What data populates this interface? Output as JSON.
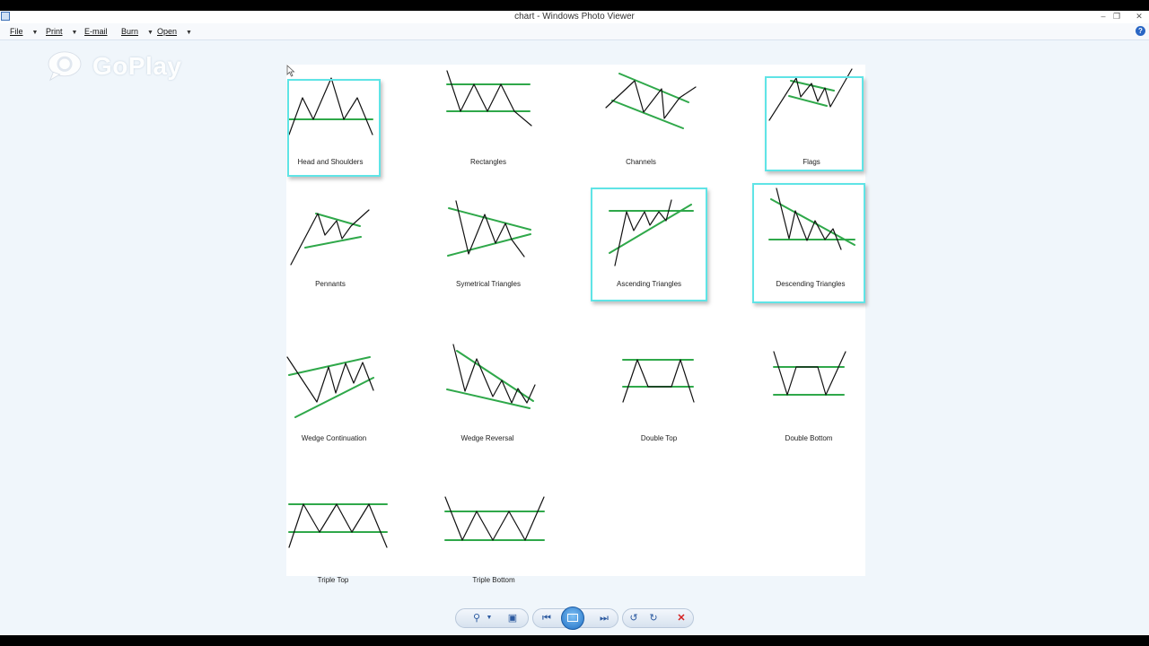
{
  "window": {
    "title": "chart - Windows Photo Viewer"
  },
  "menu": {
    "file": "File",
    "print": "Print",
    "email": "E-mail",
    "burn": "Burn",
    "open": "Open"
  },
  "watermark": {
    "text": "GoPlay"
  },
  "patterns": [
    "Head and Shoulders",
    "Rectangles",
    "Channels",
    "Flags",
    "Pennants",
    "Symetrical Triangles",
    "Ascending Triangles",
    "Descending Triangles",
    "Wedge Continuation",
    "Wedge Reversal",
    "Double Top",
    "Double Bottom",
    "Triple Top",
    "Triple Bottom"
  ],
  "toolbar_icons": [
    "zoom-icon",
    "actual-size-icon",
    "previous-icon",
    "slideshow-icon",
    "next-icon",
    "rotate-ccw-icon",
    "rotate-cw-icon",
    "delete-icon"
  ],
  "colors": {
    "trendline": "#2fa84a",
    "price": "#111111",
    "highlight": "#5fe4e6",
    "delete": "#d42020"
  }
}
